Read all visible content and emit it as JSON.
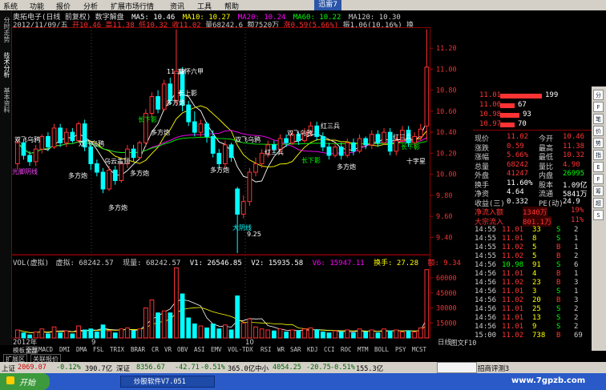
{
  "menubar": {
    "items": [
      "系统",
      "功能",
      "报价",
      "分析",
      "扩展市场行情",
      "资讯",
      "工具",
      "帮助"
    ],
    "logo": "迅雷7"
  },
  "left_tabs": [
    "分时走势",
    "技术分析",
    "基本资料"
  ],
  "chart_header": {
    "line1": {
      "stock": "奥拓电子(日线 前复权) 数字解盘",
      "ma5": "MA5: 10.46",
      "ma10": "MA10: 10.27",
      "ma20": "MA20: 10.24",
      "ma60": "MA60: 10.22",
      "ma120": "MA120: 10.30"
    },
    "line2": {
      "date": "2012/11/09/五",
      "open": "开10.46",
      "high": "高11.38",
      "low": "低10.32",
      "close": "收11.02",
      "volume": "量68242.6",
      "amount": "额7520万",
      "change": "涨0.59(5.66%)",
      "amplitude": "振1.06(10.16%)",
      "turnover": "换"
    }
  },
  "price_axis": [
    "11.20",
    "11.00",
    "10.80",
    "10.60",
    "10.40",
    "10.20",
    "10.00",
    "9.80",
    "9.60",
    "9.40"
  ],
  "vol_axis": [
    "60000",
    "45000",
    "30000",
    "15000"
  ],
  "date_axis": [
    "2012年",
    "9",
    "10",
    "日线"
  ],
  "annotations": [
    {
      "text": "光脚阴线",
      "color": "#ff44ff",
      "x": 15,
      "y": 217
    },
    {
      "text": "双飞乌鸦",
      "color": "#ffffff",
      "x": 18,
      "y": 177
    },
    {
      "text": "双飞乌鸦",
      "color": "#ffffff",
      "x": 98,
      "y": 182
    },
    {
      "text": "多方炮",
      "color": "#ffffff",
      "x": 85,
      "y": 222
    },
    {
      "text": "乌云盖顶",
      "color": "#ffffff",
      "x": 130,
      "y": 204
    },
    {
      "text": "多方炮",
      "color": "#ffffff",
      "x": 162,
      "y": 219
    },
    {
      "text": "多方炮",
      "color": "#ffffff",
      "x": 135,
      "y": 262
    },
    {
      "text": "多方炮",
      "color": "#ffffff",
      "x": 188,
      "y": 168
    },
    {
      "text": "多方炮",
      "color": "#ffffff",
      "x": 207,
      "y": 131
    },
    {
      "text": "身怀六甲",
      "color": "#ffffff",
      "x": 222,
      "y": 92
    },
    {
      "text": "长上影",
      "color": "#ffffff",
      "x": 222,
      "y": 119
    },
    {
      "text": "长下影",
      "color": "#00ff00",
      "x": 172,
      "y": 152
    },
    {
      "text": "多方炮",
      "color": "#ffffff",
      "x": 262,
      "y": 215
    },
    {
      "text": "双飞乌鸦",
      "color": "#ffffff",
      "x": 293,
      "y": 177
    },
    {
      "text": "红三兵",
      "color": "#ffffff",
      "x": 330,
      "y": 193
    },
    {
      "text": "双飞乌鸦",
      "color": "#ffffff",
      "x": 358,
      "y": 169
    },
    {
      "text": "红三兵",
      "color": "#ffffff",
      "x": 400,
      "y": 160
    },
    {
      "text": "多方炮",
      "color": "#ffffff",
      "x": 420,
      "y": 211
    },
    {
      "text": "红三兵",
      "color": "#ffffff",
      "x": 490,
      "y": 174
    },
    {
      "text": "长下影",
      "color": "#00ff00",
      "x": 500,
      "y": 186
    },
    {
      "text": "十字星",
      "color": "#ffffff",
      "x": 507,
      "y": 204
    },
    {
      "text": "大阴线",
      "color": "#00ffff",
      "x": 290,
      "y": 287
    },
    {
      "text": "长下影",
      "color": "#00ff00",
      "x": 376,
      "y": 203
    },
    {
      "text": "11.38",
      "color": "#ffffff",
      "x": 208,
      "y": 92
    },
    {
      "text": "9.25",
      "color": "#ffffff",
      "x": 308,
      "y": 295
    }
  ],
  "vol_header": {
    "label": "VOL(虚拟)",
    "virt": "虚拟: 68242.57",
    "now": "现量: 68242.57",
    "v1": "V1: 26546.85",
    "v2": "V2: 15935.58",
    "v6": "V6: 15947.11",
    "turnover": "换手: 27.28",
    "ratio": "额: 9.34"
  },
  "indicator_tabs": [
    "扩展区",
    "关联报价"
  ],
  "formula_tabs": [
    "模板",
    "全部",
    "MACD",
    "DMI",
    "DMA",
    "FSL",
    "TRIX",
    "BRAR",
    "CR",
    "VR",
    "OBV",
    "ASI",
    "EMV",
    "VOL-TDX",
    "RSI",
    "WR",
    "SAR",
    "KDJ",
    "CCI",
    "ROC",
    "MTM",
    "BOLL",
    "PSY",
    "MCST"
  ],
  "order_book": [
    {
      "price": "11.01",
      "vol": "199"
    },
    {
      "price": "11.00",
      "vol": "67"
    },
    {
      "price": "10.98",
      "vol": "93"
    },
    {
      "price": "10.97",
      "vol": "70"
    }
  ],
  "quote_rows": [
    {
      "l": "现价",
      "lv": "11.02",
      "r": "今开",
      "rv": "10.46"
    },
    {
      "l": "涨跌",
      "lv": "0.59",
      "r": "最高",
      "rv": "11.38"
    },
    {
      "l": "涨幅",
      "lv": "5.66%",
      "r": "最低",
      "rv": "10.32"
    },
    {
      "l": "总量",
      "lv": "68242",
      "r": "量比",
      "rv": "4.90"
    },
    {
      "l": "外盘",
      "lv": "41247",
      "r": "内盘",
      "rv": "26995"
    },
    {
      "l": "换手",
      "lv": "11.60%",
      "r": "股本",
      "rv": "1.09亿"
    },
    {
      "l": "净资",
      "lv": "4.64",
      "r": "流通",
      "rv": "5841万"
    },
    {
      "l": "收益(三)",
      "lv": "0.332",
      "r": "PE(动)",
      "rv": "24.9"
    }
  ],
  "flows": [
    {
      "label": "净流入额",
      "value": "1340万",
      "pct": "19%"
    },
    {
      "label": "大宗流入",
      "value": "801.1万",
      "pct": "11%"
    }
  ],
  "ticks": [
    {
      "t": "14:55",
      "p": "11.01",
      "v": "33",
      "f": "S",
      "n": "2"
    },
    {
      "t": "14:55",
      "p": "11.01",
      "v": "8",
      "f": "S",
      "n": "1"
    },
    {
      "t": "14:55",
      "p": "11.02",
      "v": "5",
      "f": "B",
      "n": "1"
    },
    {
      "t": "14:55",
      "p": "11.02",
      "v": "5",
      "f": "B",
      "n": "2"
    },
    {
      "t": "14:56",
      "p": "10.98",
      "v": "91",
      "f": "S",
      "n": "6"
    },
    {
      "t": "14:56",
      "p": "11.01",
      "v": "4",
      "f": "B",
      "n": "1"
    },
    {
      "t": "14:56",
      "p": "11.02",
      "v": "23",
      "f": "B",
      "n": "3"
    },
    {
      "t": "14:56",
      "p": "11.01",
      "v": "3",
      "f": "S",
      "n": "1"
    },
    {
      "t": "14:56",
      "p": "11.02",
      "v": "20",
      "f": "B",
      "n": "3"
    },
    {
      "t": "14:56",
      "p": "11.01",
      "v": "25",
      "f": "S",
      "n": "2"
    },
    {
      "t": "14:56",
      "p": "11.01",
      "v": "13",
      "f": "S",
      "n": "2"
    },
    {
      "t": "14:56",
      "p": "11.01",
      "v": "9",
      "f": "S",
      "n": "2"
    },
    {
      "t": "15:00",
      "p": "11.02",
      "v": "738",
      "f": "B",
      "n": "69"
    }
  ],
  "panel_footer": "图文F10",
  "status": {
    "sh_label": "上证",
    "sh_val": "2069.07",
    "sh_chg": "-0.12%",
    "sh_amt": "390.7亿",
    "sz_label": "深证",
    "sz_val": "8356.67",
    "sz_d": "-42.71",
    "sz_chg": "-0.51%",
    "sz_amt": "365.0亿",
    "zx_label": "中小",
    "zx_val": "4054.25",
    "zx_d": "-20.75",
    "zx_chg": "-0.51%",
    "zx_amt": "155.3亿",
    "right": "招商评测3"
  },
  "taskbar": {
    "start": "开始",
    "task": "炒股软件V7.051",
    "site": "www.7gpzb.com"
  },
  "right_strip": [
    "分",
    "F",
    "笔",
    "价",
    "势",
    "指",
    "E",
    "F",
    "筹",
    "超",
    "S"
  ],
  "chart_data": {
    "type": "candlestick",
    "candles": [
      {
        "o": 10.1,
        "c": 10.3,
        "h": 10.34,
        "l": 10.05
      },
      {
        "o": 10.3,
        "c": 10.18,
        "h": 10.34,
        "l": 10.14
      },
      {
        "o": 10.18,
        "c": 10.12,
        "h": 10.22,
        "l": 10.08
      },
      {
        "o": 10.12,
        "c": 10.24,
        "h": 10.28,
        "l": 10.08
      },
      {
        "o": 10.24,
        "c": 10.36,
        "h": 10.38,
        "l": 10.2
      },
      {
        "o": 10.36,
        "c": 10.26,
        "h": 10.4,
        "l": 10.22
      },
      {
        "o": 10.26,
        "c": 10.44,
        "h": 10.48,
        "l": 10.24
      },
      {
        "o": 10.44,
        "c": 10.3,
        "h": 10.48,
        "l": 10.26
      },
      {
        "o": 10.3,
        "c": 10.4,
        "h": 10.44,
        "l": 10.26
      },
      {
        "o": 10.4,
        "c": 10.32,
        "h": 10.44,
        "l": 10.3
      },
      {
        "o": 10.32,
        "c": 10.48,
        "h": 10.5,
        "l": 10.3
      },
      {
        "o": 10.48,
        "c": 10.26,
        "h": 10.52,
        "l": 10.22
      },
      {
        "o": 10.26,
        "c": 10.1,
        "h": 10.3,
        "l": 10.04
      },
      {
        "o": 10.1,
        "c": 10.02,
        "h": 10.14,
        "l": 9.98
      },
      {
        "o": 10.02,
        "c": 9.86,
        "h": 10.06,
        "l": 9.82
      },
      {
        "o": 9.86,
        "c": 10.04,
        "h": 10.08,
        "l": 9.84
      },
      {
        "o": 10.04,
        "c": 9.94,
        "h": 10.08,
        "l": 9.9
      },
      {
        "o": 9.94,
        "c": 10.1,
        "h": 10.12,
        "l": 9.92
      },
      {
        "o": 10.1,
        "c": 10.24,
        "h": 10.28,
        "l": 10.06
      },
      {
        "o": 10.24,
        "c": 10.16,
        "h": 10.28,
        "l": 10.12
      },
      {
        "o": 10.16,
        "c": 10.3,
        "h": 10.32,
        "l": 10.14
      },
      {
        "o": 10.3,
        "c": 10.58,
        "h": 10.62,
        "l": 10.26
      },
      {
        "o": 10.58,
        "c": 10.74,
        "h": 10.78,
        "l": 10.54
      },
      {
        "o": 10.74,
        "c": 10.62,
        "h": 10.8,
        "l": 10.58
      },
      {
        "o": 10.62,
        "c": 10.86,
        "h": 10.9,
        "l": 10.6
      },
      {
        "o": 10.86,
        "c": 10.7,
        "h": 10.92,
        "l": 10.66
      },
      {
        "o": 10.7,
        "c": 10.98,
        "h": 11.38,
        "l": 10.66
      },
      {
        "o": 10.98,
        "c": 10.66,
        "h": 11.02,
        "l": 10.6
      },
      {
        "o": 10.66,
        "c": 10.5,
        "h": 10.7,
        "l": 10.46
      },
      {
        "o": 10.5,
        "c": 10.4,
        "h": 10.6,
        "l": 10.36
      },
      {
        "o": 10.4,
        "c": 10.48,
        "h": 10.52,
        "l": 10.36
      },
      {
        "o": 10.48,
        "c": 10.36,
        "h": 10.5,
        "l": 10.3
      },
      {
        "o": 10.36,
        "c": 10.2,
        "h": 10.42,
        "l": 10.16
      },
      {
        "o": 10.2,
        "c": 10.1,
        "h": 10.24,
        "l": 10.06
      },
      {
        "o": 10.1,
        "c": 10.28,
        "h": 10.32,
        "l": 10.06
      },
      {
        "o": 10.28,
        "c": 10.16,
        "h": 10.3,
        "l": 10.12
      },
      {
        "o": 9.86,
        "c": 9.62,
        "h": 9.88,
        "l": 9.25
      },
      {
        "o": 9.62,
        "c": 9.74,
        "h": 9.8,
        "l": 9.58
      },
      {
        "o": 9.74,
        "c": 10.02,
        "h": 10.06,
        "l": 9.7
      },
      {
        "o": 10.02,
        "c": 10.1,
        "h": 10.16,
        "l": 9.98
      },
      {
        "o": 10.1,
        "c": 10.2,
        "h": 10.24,
        "l": 10.06
      },
      {
        "o": 10.2,
        "c": 10.28,
        "h": 10.32,
        "l": 10.16
      },
      {
        "o": 10.28,
        "c": 10.24,
        "h": 10.32,
        "l": 10.2
      },
      {
        "o": 10.24,
        "c": 10.34,
        "h": 10.38,
        "l": 10.2
      },
      {
        "o": 10.34,
        "c": 10.3,
        "h": 10.38,
        "l": 10.26
      },
      {
        "o": 10.3,
        "c": 10.38,
        "h": 10.42,
        "l": 10.28
      },
      {
        "o": 10.38,
        "c": 10.32,
        "h": 10.4,
        "l": 10.28
      },
      {
        "o": 10.32,
        "c": 10.4,
        "h": 10.44,
        "l": 10.3
      },
      {
        "o": 10.4,
        "c": 10.46,
        "h": 10.5,
        "l": 10.36
      },
      {
        "o": 10.46,
        "c": 10.36,
        "h": 10.5,
        "l": 10.32
      },
      {
        "o": 10.36,
        "c": 10.26,
        "h": 10.4,
        "l": 10.22
      },
      {
        "o": 10.26,
        "c": 10.18,
        "h": 10.3,
        "l": 10.14
      },
      {
        "o": 10.18,
        "c": 10.26,
        "h": 10.3,
        "l": 10.16
      },
      {
        "o": 10.26,
        "c": 10.18,
        "h": 10.3,
        "l": 10.14
      },
      {
        "o": 10.18,
        "c": 10.3,
        "h": 10.34,
        "l": 10.16
      },
      {
        "o": 10.3,
        "c": 10.22,
        "h": 10.34,
        "l": 10.18
      },
      {
        "o": 10.22,
        "c": 10.34,
        "h": 10.38,
        "l": 10.2
      },
      {
        "o": 10.34,
        "c": 10.28,
        "h": 10.36,
        "l": 10.24
      },
      {
        "o": 10.28,
        "c": 10.38,
        "h": 10.42,
        "l": 10.24
      },
      {
        "o": 10.38,
        "c": 10.3,
        "h": 10.42,
        "l": 10.26
      },
      {
        "o": 10.3,
        "c": 10.4,
        "h": 10.44,
        "l": 10.28
      },
      {
        "o": 10.4,
        "c": 10.22,
        "h": 10.44,
        "l": 10.18
      },
      {
        "o": 10.22,
        "c": 10.32,
        "h": 10.36,
        "l": 10.18
      },
      {
        "o": 10.32,
        "c": 10.42,
        "h": 10.46,
        "l": 10.3
      },
      {
        "o": 10.42,
        "c": 10.3,
        "h": 10.46,
        "l": 10.26
      },
      {
        "o": 10.3,
        "c": 10.36,
        "h": 10.4,
        "l": 10.26
      },
      {
        "o": 10.36,
        "c": 10.43,
        "h": 10.48,
        "l": 10.32
      },
      {
        "o": 10.46,
        "c": 11.02,
        "h": 11.38,
        "l": 10.32
      }
    ],
    "volumes": [
      8000,
      5000,
      3000,
      6000,
      9000,
      4000,
      11000,
      5000,
      7000,
      4000,
      12000,
      8000,
      9000,
      6000,
      13000,
      7000,
      5000,
      9000,
      10000,
      7000,
      9000,
      30000,
      38000,
      25000,
      27000,
      25000,
      70000,
      44000,
      20000,
      14000,
      12000,
      10000,
      14000,
      9000,
      13000,
      8000,
      42000,
      15000,
      19000,
      11000,
      9000,
      8000,
      7000,
      9000,
      6000,
      8000,
      7000,
      9000,
      10000,
      8000,
      6000,
      5000,
      7000,
      6000,
      8000,
      5000,
      9000,
      6000,
      8000,
      5000,
      9000,
      7000,
      8000,
      6000,
      7000,
      6000,
      10000,
      68242
    ],
    "ylim": [
      9.25,
      11.4
    ],
    "vol_ylim": [
      0,
      72000
    ]
  }
}
